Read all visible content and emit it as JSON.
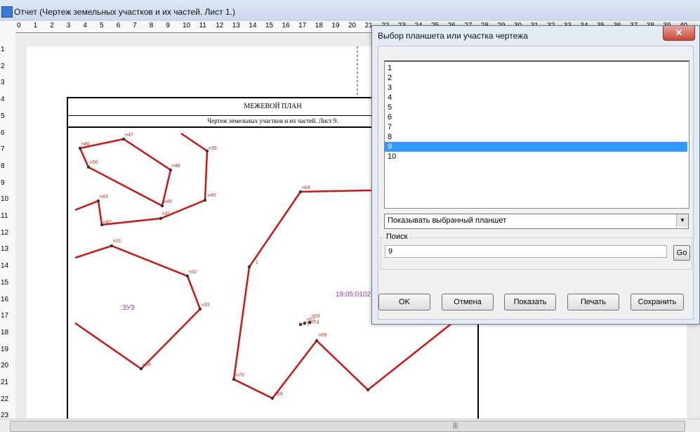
{
  "window": {
    "title": "Отчет (Чертеж земельных участков и их частей. Лист 1.)"
  },
  "ruler": {
    "h_labels": [
      "0",
      "1",
      "2",
      "3",
      "4",
      "5",
      "6",
      "7",
      "8",
      "9",
      "10",
      "11",
      "12",
      "13",
      "14",
      "15",
      "16",
      "17",
      "18",
      "19",
      "20",
      "21",
      "22",
      "23",
      "24",
      "25",
      "26",
      "27",
      "28",
      "29",
      "30",
      "31",
      "32",
      "33",
      "34",
      "35",
      "36",
      "37",
      "38",
      "39",
      "40"
    ],
    "v_labels": [
      "1",
      "2",
      "3",
      "4",
      "5",
      "6",
      "7",
      "8",
      "9",
      "10",
      "11",
      "12",
      "13",
      "14",
      "15",
      "16",
      "17",
      "18",
      "19",
      "20",
      "21",
      "22",
      "23"
    ]
  },
  "drawing": {
    "header_title": "МЕЖЕВОЙ ПЛАН",
    "header_subtitle": "Чертеж земельных участков и их частей. Лист 9.",
    "zone_label": ":ЗУ3",
    "cadastral_label": "19:05:0102",
    "point_labels": [
      "н46",
      "н47",
      "н50",
      "н48",
      "н49",
      "н39",
      "н40",
      "н43",
      "н42",
      "н41",
      "н64",
      "н31",
      "н32",
      "н33",
      "н34",
      "1",
      "н70",
      "н69",
      "н68",
      "н53",
      "н52",
      "н74",
      "н71"
    ],
    "line_color": "#d21414",
    "label_color": "#c0392b",
    "accent_label_color": "#b030c0"
  },
  "dialog": {
    "title": "Выбор планшета или участка чертежа",
    "list_items": [
      "1",
      "2",
      "3",
      "4",
      "5",
      "6",
      "7",
      "8",
      "9",
      "10"
    ],
    "selected_item": "9",
    "combo_value": "Показывать выбранный планшет",
    "search_group_label": "Поиск",
    "search_value": "9",
    "go_label": "Go",
    "buttons": {
      "ok": "OK",
      "cancel": "Отмена",
      "show": "Показать",
      "print": "Печать",
      "save": "Сохранить"
    },
    "selection_color": "#3399ff"
  }
}
